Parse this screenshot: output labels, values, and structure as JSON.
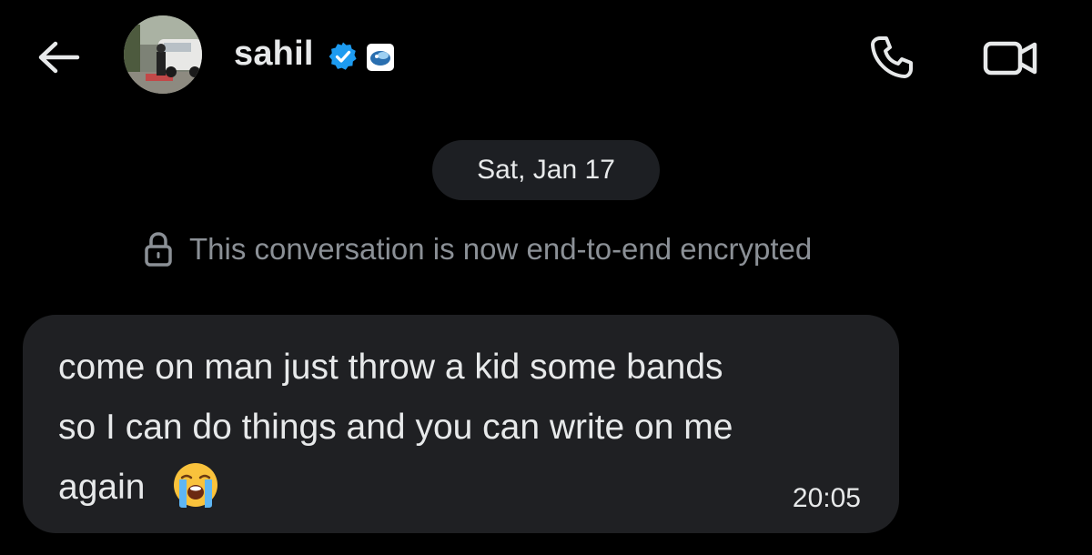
{
  "header": {
    "back_icon": "arrow-left-icon",
    "contact_name": "sahil",
    "verified_icon": "verified-badge-icon",
    "affiliate_icon": "affiliate-badge-icon",
    "call_icon": "phone-icon",
    "video_icon": "video-camera-icon"
  },
  "conversation": {
    "date_label": "Sat, Jan 17",
    "encryption_notice": "This conversation is now end-to-end encrypted",
    "encryption_icon": "lock-icon"
  },
  "messages": [
    {
      "lines": [
        "come on man just throw a kid some bands",
        "so I can do things and you can write on me",
        "again"
      ],
      "emoji": "loudly-crying-face-icon",
      "time": "20:05"
    }
  ],
  "colors": {
    "background": "#000000",
    "bubble": "#1f2023",
    "pill": "#1d1f23",
    "text": "#e7e9ea",
    "muted_text": "#8b9096",
    "verified_blue": "#1d9bf0"
  }
}
